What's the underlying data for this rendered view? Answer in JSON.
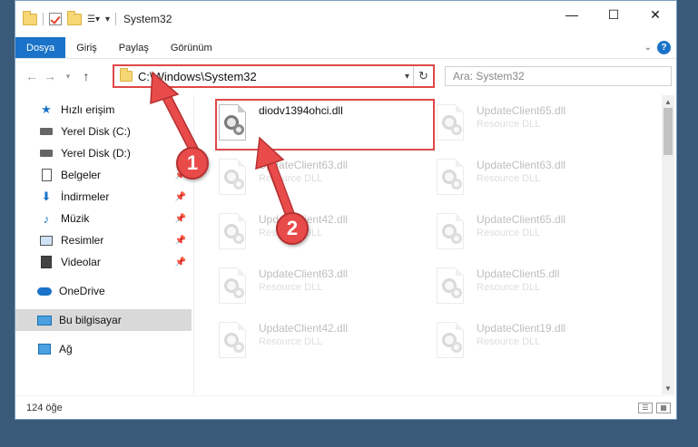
{
  "window": {
    "title": "System32"
  },
  "ribbon": {
    "tabs": [
      "Dosya",
      "Giriş",
      "Paylaş",
      "Görünüm"
    ]
  },
  "address": {
    "path": "C:\\Windows\\System32"
  },
  "search": {
    "placeholder": "Ara: System32"
  },
  "sidebar": {
    "items": [
      {
        "label": "Hızlı erişim",
        "icon": "star-icon",
        "pinned": false
      },
      {
        "label": "Yerel Disk (C:)",
        "icon": "drive-icon",
        "pinned": false
      },
      {
        "label": "Yerel Disk (D:)",
        "icon": "drive-icon",
        "pinned": false
      },
      {
        "label": "Belgeler",
        "icon": "document-icon",
        "pinned": true
      },
      {
        "label": "İndirmeler",
        "icon": "download-icon",
        "pinned": true
      },
      {
        "label": "Müzik",
        "icon": "music-icon",
        "pinned": true
      },
      {
        "label": "Resimler",
        "icon": "pictures-icon",
        "pinned": true
      },
      {
        "label": "Videolar",
        "icon": "video-icon",
        "pinned": true
      },
      {
        "label": "OneDrive",
        "icon": "cloud-icon",
        "pinned": false
      },
      {
        "label": "Bu bilgisayar",
        "icon": "computer-icon",
        "pinned": false,
        "selected": true
      },
      {
        "label": "Ağ",
        "icon": "network-icon",
        "pinned": false
      }
    ]
  },
  "files": [
    {
      "name": "diodv1394ohci.dll",
      "type": "",
      "highlighted": true
    },
    {
      "name": "UpdateClient65.dll",
      "type": "Resource DLL"
    },
    {
      "name": "UpdateClient63.dll",
      "type": "Resource DLL"
    },
    {
      "name": "UpdateClient63.dll",
      "type": "Resource DLL"
    },
    {
      "name": "UpdateClient42.dll",
      "type": "Resource DLL"
    },
    {
      "name": "UpdateClient65.dll",
      "type": "Resource DLL"
    },
    {
      "name": "UpdateClient63.dll",
      "type": "Resource DLL"
    },
    {
      "name": "UpdateClient5.dll",
      "type": "Resource DLL"
    },
    {
      "name": "UpdateClient42.dll",
      "type": "Resource DLL"
    },
    {
      "name": "UpdateClient19.dll",
      "type": "Resource DLL"
    }
  ],
  "status": {
    "item_count": "124 öğe"
  },
  "annotations": {
    "step1": "1",
    "step2": "2",
    "color": "#e94b4b"
  }
}
